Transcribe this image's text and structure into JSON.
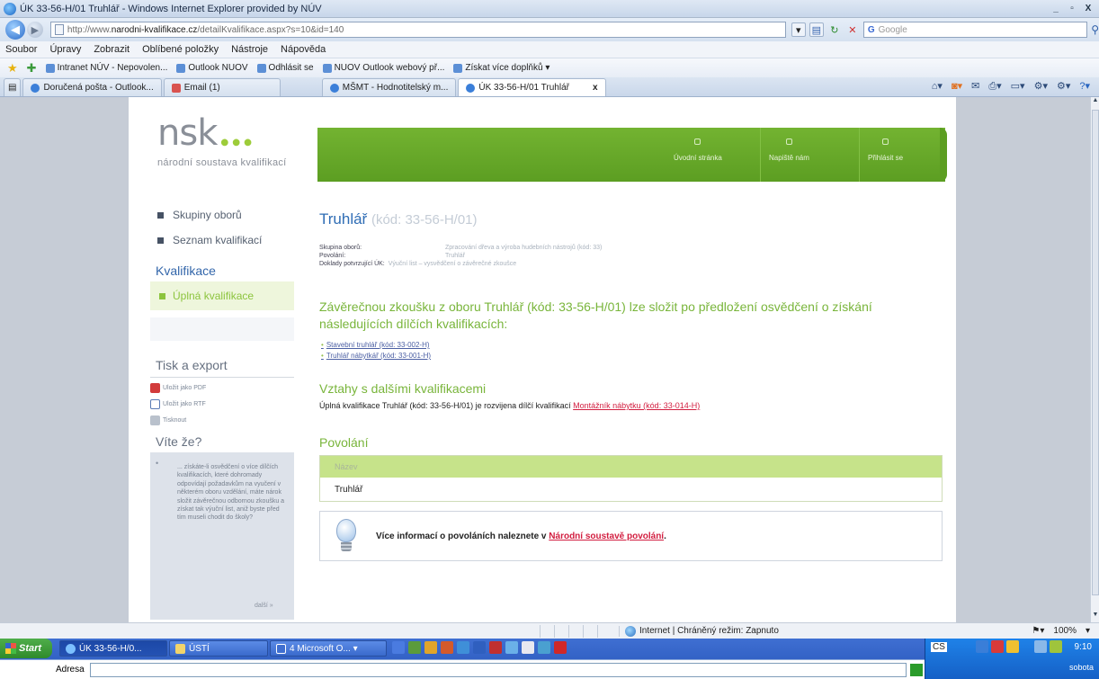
{
  "window": {
    "title": "ÚK 33-56-H/01 Truhlář - Windows Internet Explorer provided by NÚV",
    "min": "_",
    "max": "▫",
    "close": "X"
  },
  "address": {
    "url_prefix": "http://www.",
    "url_domain": "narodni-kvalifikace.cz",
    "url_path": "/detailKvalifikace.aspx?s=10&id=140",
    "search_placeholder": "Google"
  },
  "menu": [
    "Soubor",
    "Úpravy",
    "Zobrazit",
    "Oblíbené položky",
    "Nástroje",
    "Nápověda"
  ],
  "favorites": [
    "Intranet NÚV - Nepovolen...",
    "Outlook NUOV",
    "Odhlásit se",
    "NUOV Outlook webový př...",
    "Získat více doplňků ▾"
  ],
  "tabs": [
    {
      "label": "Doručená pošta - Outlook..."
    },
    {
      "label": "Email (1)"
    },
    {
      "label": "MŠMT - Hodnotitelský m..."
    },
    {
      "label": "ÚK 33-56-H/01 Truhlář",
      "close": "x"
    }
  ],
  "site": {
    "logo": "nsk",
    "logo_dots": "●●●",
    "logo_sub": "národní soustava kvalifikací",
    "topnav": [
      "Úvodní stránka",
      "Napiště nám",
      "Přihlásit se"
    ],
    "left": {
      "skupiny": "Skupiny oborů",
      "seznam": "Seznam kvalifikací",
      "section": "Kvalifikace",
      "active": "Úplná kvalifikace",
      "tisk_title": "Tisk a export",
      "tisk": [
        "Uložit jako PDF",
        "Uložit jako RTF",
        "Tisknout"
      ],
      "vite_title": "Víte že?",
      "vite_bullet": "•",
      "vite_text": "... získáte-li osvědčení o více dílčích kvalifikacích, které dohromady odpovídají požadavkům na vyučení v některém oboru vzdělání, máte nárok složit závěrečnou odbornou zkoušku a získat tak výuční list, aniž byste před tím museli chodit do školy?",
      "vite_more": "další »"
    },
    "main": {
      "title": "Truhlář",
      "code": "(kód: 33-56-H/01)",
      "meta": [
        {
          "k": "Skupina oborů:",
          "v": "Zpracování dřeva a výroba hudebních nástrojů (kód: 33)"
        },
        {
          "k": "Povolání:",
          "v": "Truhlář"
        },
        {
          "k": "Doklady potvrzující ÚK:",
          "v": "Výuční list – vysvědčení o závěrečné zkoušce"
        }
      ],
      "lead": "Závěrečnou zkoušku z oboru Truhlář (kód: 33-56-H/01) lze složit po předložení osvědčení o získání následujících dílčích kvalifikacích:",
      "dilci": [
        "Stavební truhlář (kód: 33-002-H)",
        "Truhlář nábytkář (kód: 33-001-H)"
      ],
      "bullet": "•",
      "vztahy_title": "Vztahy s dalšími kvalifikacemi",
      "vztahy_text": "Úplná kvalifikace Truhlář (kód: 33-56-H/01) je rozvijena dílčí kvalifikací",
      "vztahy_link": "Montážník nábytku (kód: 33-014-H)",
      "povolani_title": "Povolání",
      "table_header": "Název",
      "table_row": "Truhlář",
      "info_text": "Více informací o povoláních naleznete v",
      "info_link": "Národní soustavě povolání",
      "info_end": "."
    }
  },
  "status": {
    "zone": "Internet | Chráněný režim: Zapnuto",
    "zoom": "100%"
  },
  "taskbar": {
    "start": "Start",
    "buttons": [
      "ÚK 33-56-H/0...",
      "ÚSTÍ",
      "4 Microsoft O... ▾"
    ],
    "address_label": "Adresa",
    "lang": "CS",
    "time": "9:10",
    "day": "sobota"
  }
}
